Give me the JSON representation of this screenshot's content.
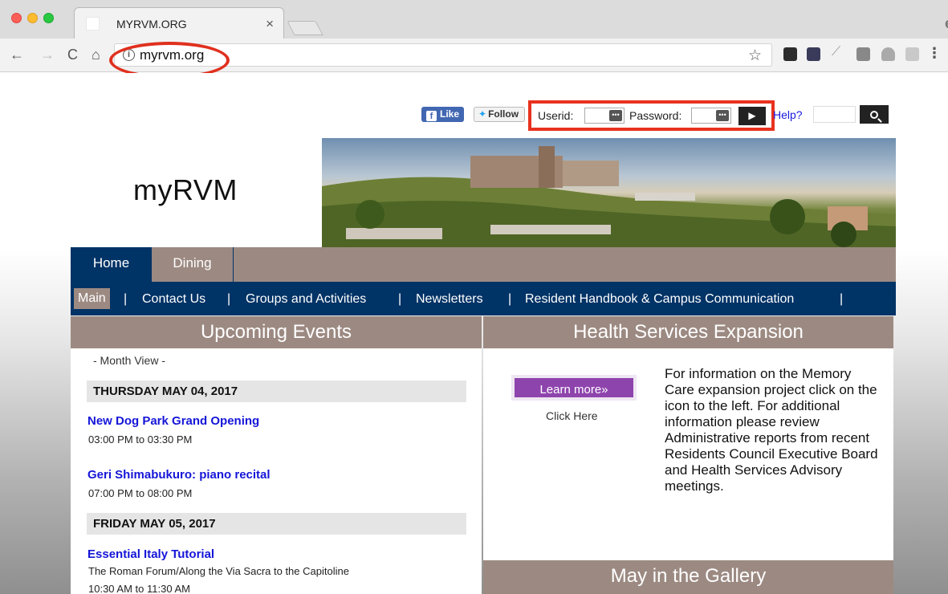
{
  "browser": {
    "tab_title": "MYRVM.ORG",
    "tab_close": "×",
    "url": "myrvm.org",
    "info_icon": "i",
    "star_glyph": "☆",
    "back_glyph": "←",
    "forward_glyph": "→",
    "reload_glyph": "C",
    "home_glyph": "⌂",
    "menu_glyph": "⋮",
    "profile_glyph": "e"
  },
  "social": {
    "like_f": "f",
    "like_label": "Like",
    "follow_label": "Follow",
    "bird": "🐦"
  },
  "login": {
    "userid_label": "Userid:",
    "password_label": "Password:",
    "dots": "•••",
    "go_glyph": "▶",
    "help_label": "Help?"
  },
  "site": {
    "logo": "myRVM"
  },
  "nav": {
    "tabs": [
      {
        "label": "Home"
      },
      {
        "label": "Dining"
      }
    ]
  },
  "subnav": {
    "items": [
      {
        "label": "Main"
      },
      {
        "label": "Contact Us"
      },
      {
        "label": "Groups and Activities"
      },
      {
        "label": "Newsletters"
      },
      {
        "label": "Resident Handbook & Campus Communication"
      }
    ],
    "separator": "|"
  },
  "events": {
    "heading": "Upcoming Events",
    "month_view": "- Month View -",
    "days": [
      {
        "date": "THURSDAY MAY 04, 2017",
        "events": [
          {
            "title": "New Dog Park Grand Opening",
            "time": "03:00 PM to 03:30 PM"
          },
          {
            "title": "Geri Shimabukuro: piano recital",
            "time": "07:00 PM to 08:00 PM"
          }
        ]
      },
      {
        "date": "FRIDAY MAY 05, 2017",
        "events": [
          {
            "title": "Essential Italy Tutorial",
            "subtitle": "The Roman Forum/Along the Via Sacra to the Capitoline",
            "time": "10:30 AM to 11:30 AM"
          }
        ]
      }
    ]
  },
  "health": {
    "heading": "Health Services Expansion",
    "button": "Learn more»",
    "click_here": "Click Here",
    "text": "For information on the Memory Care expansion project click on the icon to the left.  For additional information please review Administrative reports from recent Residents Council Executive Board and Health Services Advisory meetings."
  },
  "gallery": {
    "heading": "May in the Gallery"
  },
  "colors": {
    "nav_blue": "#003366",
    "taupe": "#9c8a82",
    "link_blue": "#1515d8",
    "purple": "#8e44ad",
    "highlight_red": "#e8321f"
  }
}
